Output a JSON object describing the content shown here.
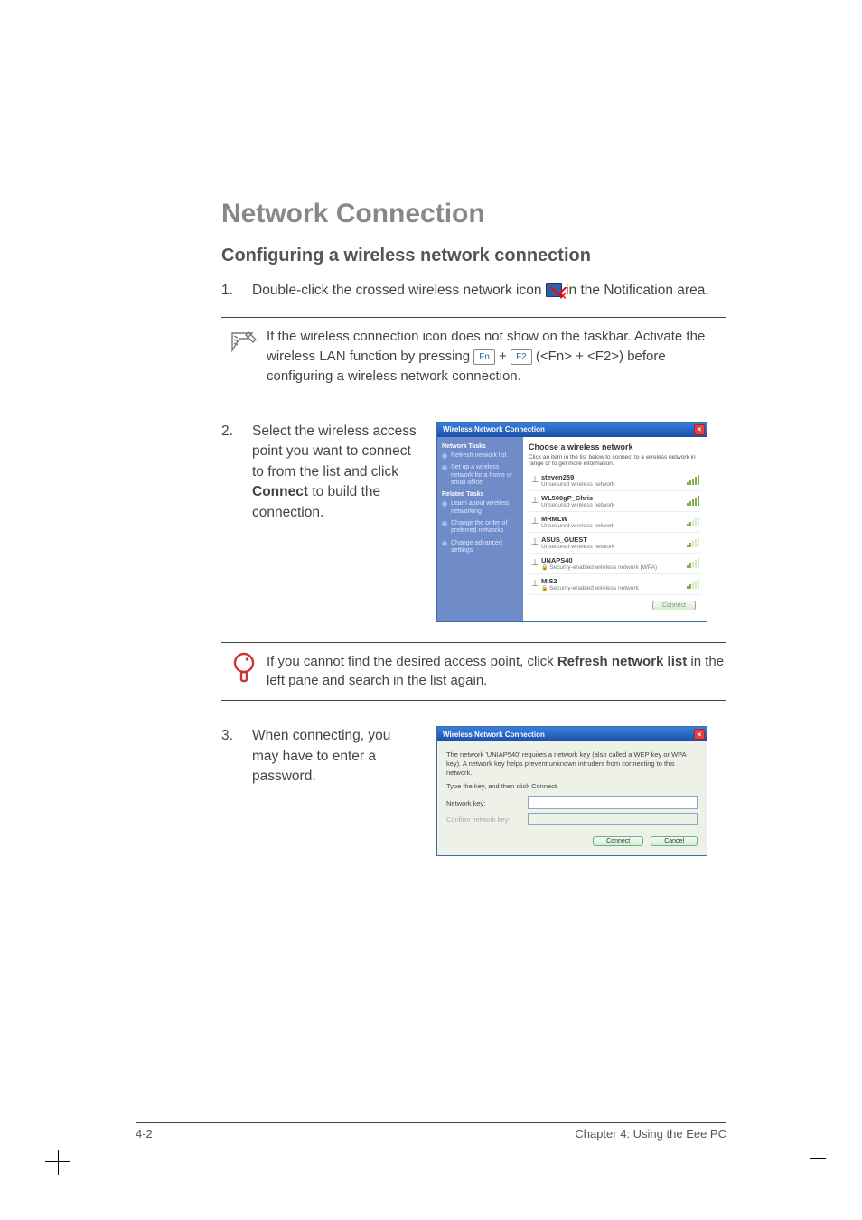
{
  "headings": {
    "h1": "Network Connection",
    "h2": "Configuring a wireless network connection"
  },
  "steps": {
    "s1": {
      "num": "1.",
      "before": "Double-click the crossed wireless network icon ",
      "after": " in the Notification area."
    },
    "s2": {
      "num": "2.",
      "before": "Select the wireless access point you want to connect to from the list and click ",
      "bold": "Connect",
      "after": " to build the connection."
    },
    "s3": {
      "num": "3.",
      "text": "When connecting, you may have to enter a password."
    }
  },
  "note1": {
    "line1": "If the wireless connection icon does not show on the taskbar. Activate the wireless LAN function by pressing ",
    "key1": "Fn",
    "plus": " + ",
    "key2": "F2",
    "paren": " (<Fn> + <F2>) before configuring a wireless network connection."
  },
  "tip": {
    "before": "If you cannot find the desired access point, click ",
    "bold": "Refresh network list",
    "after": " in the left pane and search in the list again."
  },
  "win1": {
    "title": "Wireless Network Connection",
    "side": {
      "sec1": "Network Tasks",
      "items1": [
        "Refresh network list",
        "Set up a wireless network for a home or small office"
      ],
      "sec2": "Related Tasks",
      "items2": [
        "Learn about wireless networking",
        "Change the order of preferred networks",
        "Change advanced settings"
      ]
    },
    "main": {
      "head": "Choose a wireless network",
      "sub": "Click an item in the list below to connect to a wireless network in range or to get more information.",
      "networks": [
        {
          "name": "steven259",
          "sec": "Unsecured wireless network",
          "secure": false,
          "sig": "hi"
        },
        {
          "name": "WL500gP_Chris",
          "sec": "Unsecured wireless network",
          "secure": false,
          "sig": "hi"
        },
        {
          "name": "MRMLW",
          "sec": "Unsecured wireless network",
          "secure": false,
          "sig": "mid"
        },
        {
          "name": "ASUS_GUEST",
          "sec": "Unsecured wireless network",
          "secure": false,
          "sig": "mid"
        },
        {
          "name": "UNAPS40",
          "sec": "Security-enabled wireless network (WPA)",
          "secure": true,
          "sig": "mid"
        },
        {
          "name": "MIS2",
          "sec": "Security-enabled wireless network",
          "secure": true,
          "sig": "mid"
        }
      ],
      "connect": "Connect"
    }
  },
  "win2": {
    "title": "Wireless Network Connection",
    "desc": "The network 'UNIAP540' requires a network key (also called a WEP key or WPA key). A network key helps prevent unknown intruders from connecting to this network.",
    "type": "Type the key, and then click Connect.",
    "label1": "Network key:",
    "label2": "Confirm network key:",
    "btn_connect": "Connect",
    "btn_cancel": "Cancel"
  },
  "footer": {
    "pagenum": "4-2",
    "chapter": "Chapter 4: Using the Eee PC"
  }
}
